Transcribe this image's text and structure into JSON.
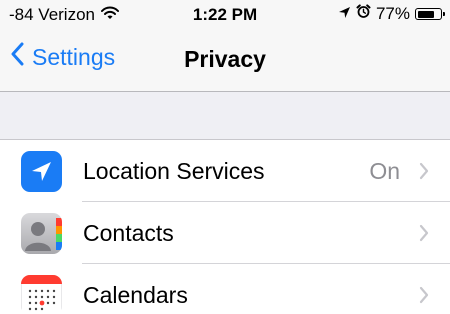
{
  "status_bar": {
    "carrier": "-84 Verizon",
    "time": "1:22 PM",
    "battery_percent": "77%",
    "battery_level": 0.77,
    "icons": [
      "wifi-icon",
      "location-arrow-icon",
      "alarm-icon",
      "battery-icon"
    ]
  },
  "nav": {
    "back_label": "Settings",
    "title": "Privacy"
  },
  "privacy_items": [
    {
      "label": "Location Services",
      "value": "On",
      "icon": "location-services-icon",
      "icon_color": "#1a7cf5"
    },
    {
      "label": "Contacts",
      "value": "",
      "icon": "contacts-icon",
      "icon_color": "#8e8e93"
    },
    {
      "label": "Calendars",
      "value": "",
      "icon": "calendars-icon",
      "icon_color": "#ff3b30"
    }
  ],
  "colors": {
    "accent": "#1a7cf5",
    "background": "#efeff4",
    "secondary_text": "#8e8e93",
    "chevron": "#c7c7cc"
  }
}
